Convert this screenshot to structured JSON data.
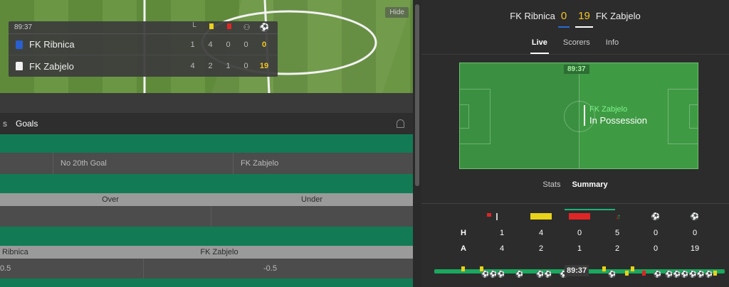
{
  "left": {
    "hide_label": "Hide",
    "scoreboard": {
      "time": "89:37",
      "teams": [
        {
          "name": "FK Ribnica",
          "corners": "1",
          "yellow": "4",
          "red": "0",
          "subs": "0",
          "score": "0",
          "shirt_color": "#2a5fd0"
        },
        {
          "name": "FK Zabjelo",
          "corners": "4",
          "yellow": "2",
          "red": "1",
          "subs": "0",
          "score": "19",
          "shirt_color": "#f0f0f0"
        }
      ]
    },
    "market_tabs": [
      "s",
      "Goals"
    ],
    "markets": [
      {
        "type": "three",
        "cells": [
          "",
          "No 20th Goal",
          "FK Zabjelo"
        ]
      },
      {
        "type": "ou",
        "headers": [
          "Over",
          "Under"
        ]
      },
      {
        "type": "hcap",
        "headers": [
          "Ribnica",
          "FK Zabjelo"
        ],
        "values": [
          "0.5",
          "-0.5"
        ]
      }
    ]
  },
  "right": {
    "header": {
      "home": "FK Ribnica",
      "home_score": "0",
      "away_score": "19",
      "away": "FK Zabjelo"
    },
    "tabs": [
      {
        "label": "Live",
        "active": true
      },
      {
        "label": "Scorers",
        "active": false
      },
      {
        "label": "Info",
        "active": false
      }
    ],
    "pitch": {
      "clock": "89:37",
      "team": "FK Zabjelo",
      "status": "In Possession"
    },
    "summary_tabs": [
      {
        "label": "Stats",
        "active": false
      },
      {
        "label": "Summary",
        "active": true
      }
    ],
    "stat_icons": [
      "corner-flag-icon",
      "yellow-card-icon",
      "red-card-icon",
      "substitution-icon",
      "penalty-icon",
      "goal-icon"
    ],
    "rows": [
      {
        "label": "H",
        "values": [
          "1",
          "4",
          "0",
          "5",
          "0",
          "0"
        ]
      },
      {
        "label": "A",
        "values": [
          "4",
          "2",
          "1",
          "2",
          "0",
          "19"
        ]
      }
    ],
    "timeline_clock": "89:37",
    "colors": {
      "accent": "#1ab37a",
      "score": "#f3c623",
      "pitch": "#3f9a44"
    }
  }
}
